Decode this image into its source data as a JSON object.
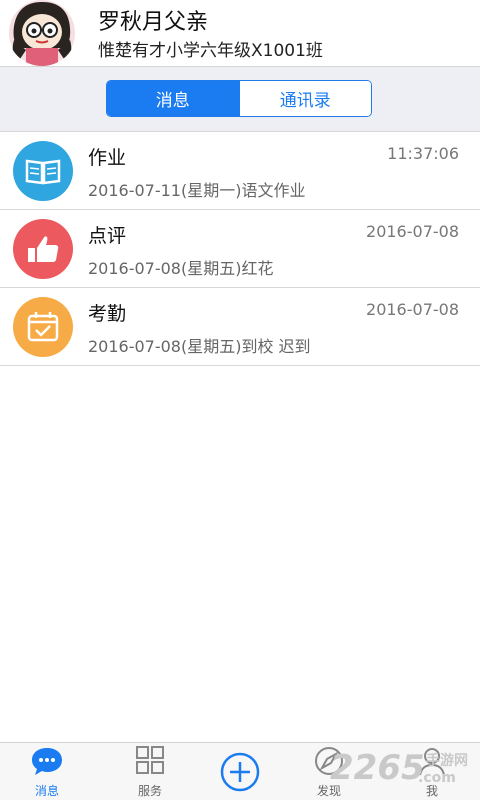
{
  "user": {
    "name": "罗秋月父亲",
    "class_name": "惟楚有才小学六年级X1001班"
  },
  "tabs": [
    {
      "label": "消息",
      "active": true
    },
    {
      "label": "通讯录",
      "active": false
    }
  ],
  "messages": [
    {
      "title": "作业",
      "time": "11:37:06",
      "summary": "2016-07-11(星期一)语文作业",
      "icon": "book-icon",
      "color": "#2fa6e0"
    },
    {
      "title": "点评",
      "time": "2016-07-08",
      "summary": "2016-07-08(星期五)红花",
      "icon": "thumbs-up-icon",
      "color": "#ec5a60"
    },
    {
      "title": "考勤",
      "time": "2016-07-08",
      "summary": "2016-07-08(星期五)到校 迟到",
      "icon": "calendar-check-icon",
      "color": "#f7ab46"
    }
  ],
  "bottom_nav": [
    {
      "label": "消息",
      "icon": "chat-bubble-icon",
      "active": true
    },
    {
      "label": "服务",
      "icon": "grid-icon",
      "active": false
    },
    {
      "label": "",
      "icon": "plus-circle-icon",
      "active": false
    },
    {
      "label": "发现",
      "icon": "compass-icon",
      "active": false
    },
    {
      "label": "我",
      "icon": "person-icon",
      "active": false
    }
  ],
  "watermark": {
    "brand": "2265",
    "tld": ".com",
    "tagline": "手游网"
  },
  "colors": {
    "accent": "#1a7cf0",
    "segment_bar_bg": "#eeeff4"
  }
}
